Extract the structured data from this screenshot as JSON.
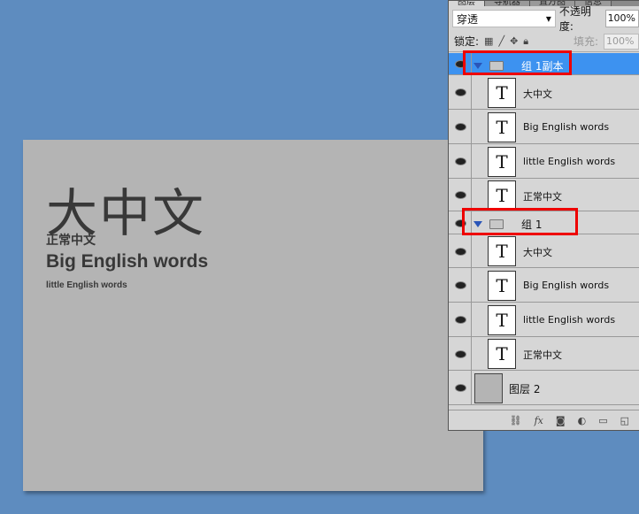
{
  "canvas": {
    "big_chinese": "大中文",
    "normal_chinese": "正常中文",
    "big_english": "Big English words",
    "little_english": "little English words"
  },
  "panel": {
    "tabs": [
      "图层",
      "导航器",
      "直方图",
      "信息"
    ],
    "blend_mode": "穿透",
    "opacity_label": "不透明度:",
    "opacity": "100%",
    "lock_label": "锁定:",
    "fill_label": "填充:",
    "fill": "100%",
    "layers": [
      {
        "type": "group",
        "name": "组 1副本",
        "selected": true
      },
      {
        "type": "text",
        "name": "大中文"
      },
      {
        "type": "text",
        "name": "Big English words"
      },
      {
        "type": "text",
        "name": "little English words"
      },
      {
        "type": "text",
        "name": "正常中文"
      },
      {
        "type": "group",
        "name": "组 1"
      },
      {
        "type": "text",
        "name": "大中文"
      },
      {
        "type": "text",
        "name": "Big English words"
      },
      {
        "type": "text",
        "name": "little English words"
      },
      {
        "type": "text",
        "name": "正常中文"
      },
      {
        "type": "image",
        "name": "图层 2"
      }
    ],
    "text_thumb": "T",
    "footer_icons": [
      "link-icon",
      "fx-icon",
      "mask-icon",
      "adjustment-icon",
      "new-group-icon",
      "new-layer-icon"
    ],
    "fx": "fx"
  },
  "colors": {
    "background": "#5e8cbf",
    "selection": "#3d92f0",
    "highlight_box": "#e00000"
  }
}
